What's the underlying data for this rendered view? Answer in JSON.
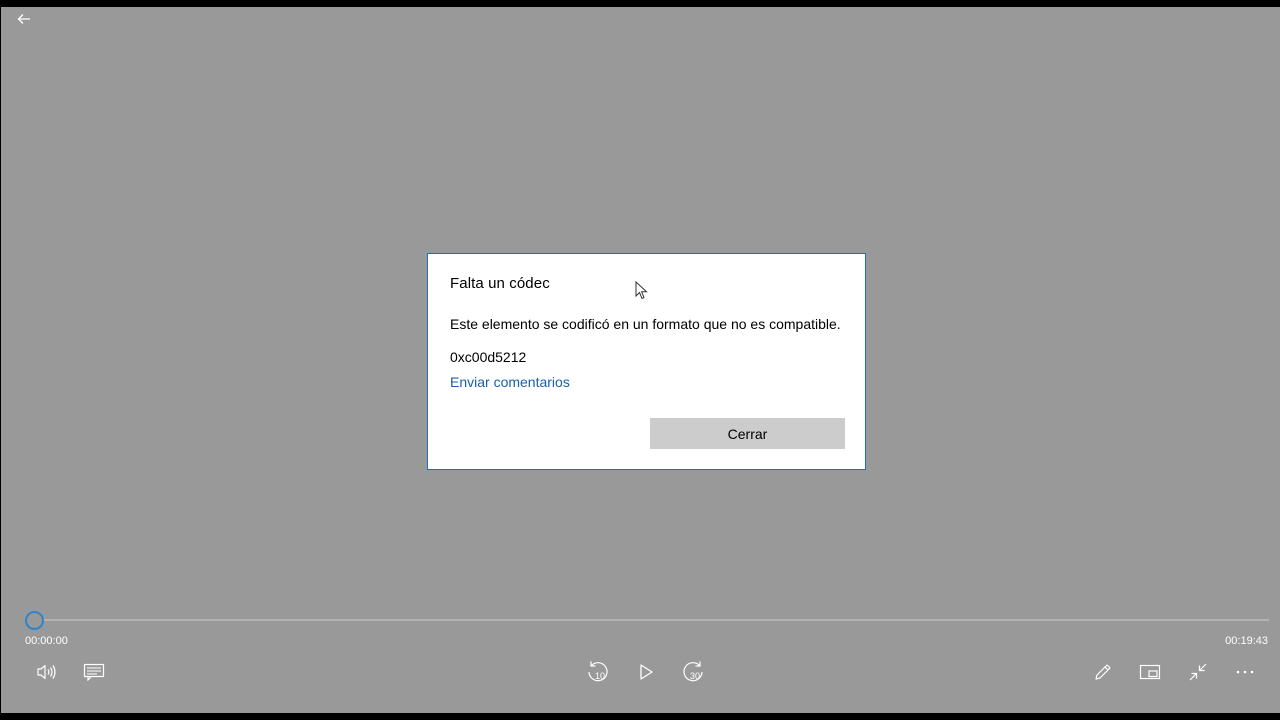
{
  "dialog": {
    "title": "Falta un códec",
    "message": "Este elemento se codificó en un formato que no es compatible.",
    "error_code": "0xc00d5212",
    "feedback_link": "Enviar comentarios",
    "close_label": "Cerrar"
  },
  "player": {
    "current_time": "00:00:00",
    "total_time": "00:19:43",
    "progress": 0,
    "skip_back_seconds": "10",
    "skip_forward_seconds": "30"
  },
  "icons": {
    "back": "back-arrow-icon",
    "volume": "volume-icon",
    "subtitles": "subtitles-icon",
    "skip_back": "skip-back-10-icon",
    "play": "play-icon",
    "skip_forward": "skip-forward-30-icon",
    "edit": "pencil-icon",
    "mini_view": "mini-view-icon",
    "exit_fullscreen": "exit-fullscreen-icon",
    "more": "more-options-icon"
  },
  "colors": {
    "background": "#999999",
    "dialog_border": "#1a6fbf",
    "link": "#1a5fa8",
    "button": "#cccccc",
    "seek_thumb": "#2e83c9"
  }
}
